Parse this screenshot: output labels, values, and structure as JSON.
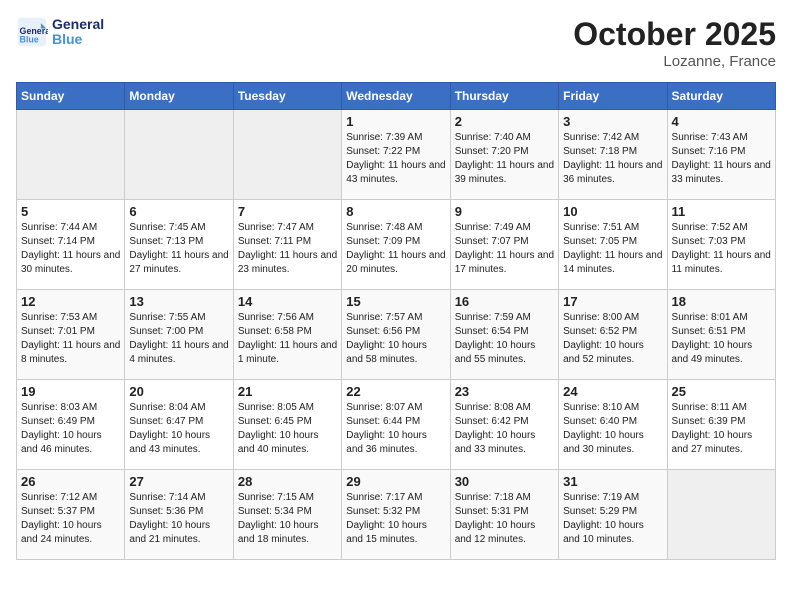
{
  "header": {
    "logo_line1": "General",
    "logo_line2": "Blue",
    "month": "October 2025",
    "location": "Lozanne, France"
  },
  "days_of_week": [
    "Sunday",
    "Monday",
    "Tuesday",
    "Wednesday",
    "Thursday",
    "Friday",
    "Saturday"
  ],
  "weeks": [
    [
      {
        "day": "",
        "info": ""
      },
      {
        "day": "",
        "info": ""
      },
      {
        "day": "",
        "info": ""
      },
      {
        "day": "1",
        "info": "Sunrise: 7:39 AM\nSunset: 7:22 PM\nDaylight: 11 hours and 43 minutes."
      },
      {
        "day": "2",
        "info": "Sunrise: 7:40 AM\nSunset: 7:20 PM\nDaylight: 11 hours and 39 minutes."
      },
      {
        "day": "3",
        "info": "Sunrise: 7:42 AM\nSunset: 7:18 PM\nDaylight: 11 hours and 36 minutes."
      },
      {
        "day": "4",
        "info": "Sunrise: 7:43 AM\nSunset: 7:16 PM\nDaylight: 11 hours and 33 minutes."
      }
    ],
    [
      {
        "day": "5",
        "info": "Sunrise: 7:44 AM\nSunset: 7:14 PM\nDaylight: 11 hours and 30 minutes."
      },
      {
        "day": "6",
        "info": "Sunrise: 7:45 AM\nSunset: 7:13 PM\nDaylight: 11 hours and 27 minutes."
      },
      {
        "day": "7",
        "info": "Sunrise: 7:47 AM\nSunset: 7:11 PM\nDaylight: 11 hours and 23 minutes."
      },
      {
        "day": "8",
        "info": "Sunrise: 7:48 AM\nSunset: 7:09 PM\nDaylight: 11 hours and 20 minutes."
      },
      {
        "day": "9",
        "info": "Sunrise: 7:49 AM\nSunset: 7:07 PM\nDaylight: 11 hours and 17 minutes."
      },
      {
        "day": "10",
        "info": "Sunrise: 7:51 AM\nSunset: 7:05 PM\nDaylight: 11 hours and 14 minutes."
      },
      {
        "day": "11",
        "info": "Sunrise: 7:52 AM\nSunset: 7:03 PM\nDaylight: 11 hours and 11 minutes."
      }
    ],
    [
      {
        "day": "12",
        "info": "Sunrise: 7:53 AM\nSunset: 7:01 PM\nDaylight: 11 hours and 8 minutes."
      },
      {
        "day": "13",
        "info": "Sunrise: 7:55 AM\nSunset: 7:00 PM\nDaylight: 11 hours and 4 minutes."
      },
      {
        "day": "14",
        "info": "Sunrise: 7:56 AM\nSunset: 6:58 PM\nDaylight: 11 hours and 1 minute."
      },
      {
        "day": "15",
        "info": "Sunrise: 7:57 AM\nSunset: 6:56 PM\nDaylight: 10 hours and 58 minutes."
      },
      {
        "day": "16",
        "info": "Sunrise: 7:59 AM\nSunset: 6:54 PM\nDaylight: 10 hours and 55 minutes."
      },
      {
        "day": "17",
        "info": "Sunrise: 8:00 AM\nSunset: 6:52 PM\nDaylight: 10 hours and 52 minutes."
      },
      {
        "day": "18",
        "info": "Sunrise: 8:01 AM\nSunset: 6:51 PM\nDaylight: 10 hours and 49 minutes."
      }
    ],
    [
      {
        "day": "19",
        "info": "Sunrise: 8:03 AM\nSunset: 6:49 PM\nDaylight: 10 hours and 46 minutes."
      },
      {
        "day": "20",
        "info": "Sunrise: 8:04 AM\nSunset: 6:47 PM\nDaylight: 10 hours and 43 minutes."
      },
      {
        "day": "21",
        "info": "Sunrise: 8:05 AM\nSunset: 6:45 PM\nDaylight: 10 hours and 40 minutes."
      },
      {
        "day": "22",
        "info": "Sunrise: 8:07 AM\nSunset: 6:44 PM\nDaylight: 10 hours and 36 minutes."
      },
      {
        "day": "23",
        "info": "Sunrise: 8:08 AM\nSunset: 6:42 PM\nDaylight: 10 hours and 33 minutes."
      },
      {
        "day": "24",
        "info": "Sunrise: 8:10 AM\nSunset: 6:40 PM\nDaylight: 10 hours and 30 minutes."
      },
      {
        "day": "25",
        "info": "Sunrise: 8:11 AM\nSunset: 6:39 PM\nDaylight: 10 hours and 27 minutes."
      }
    ],
    [
      {
        "day": "26",
        "info": "Sunrise: 7:12 AM\nSunset: 5:37 PM\nDaylight: 10 hours and 24 minutes."
      },
      {
        "day": "27",
        "info": "Sunrise: 7:14 AM\nSunset: 5:36 PM\nDaylight: 10 hours and 21 minutes."
      },
      {
        "day": "28",
        "info": "Sunrise: 7:15 AM\nSunset: 5:34 PM\nDaylight: 10 hours and 18 minutes."
      },
      {
        "day": "29",
        "info": "Sunrise: 7:17 AM\nSunset: 5:32 PM\nDaylight: 10 hours and 15 minutes."
      },
      {
        "day": "30",
        "info": "Sunrise: 7:18 AM\nSunset: 5:31 PM\nDaylight: 10 hours and 12 minutes."
      },
      {
        "day": "31",
        "info": "Sunrise: 7:19 AM\nSunset: 5:29 PM\nDaylight: 10 hours and 10 minutes."
      },
      {
        "day": "",
        "info": ""
      }
    ]
  ]
}
